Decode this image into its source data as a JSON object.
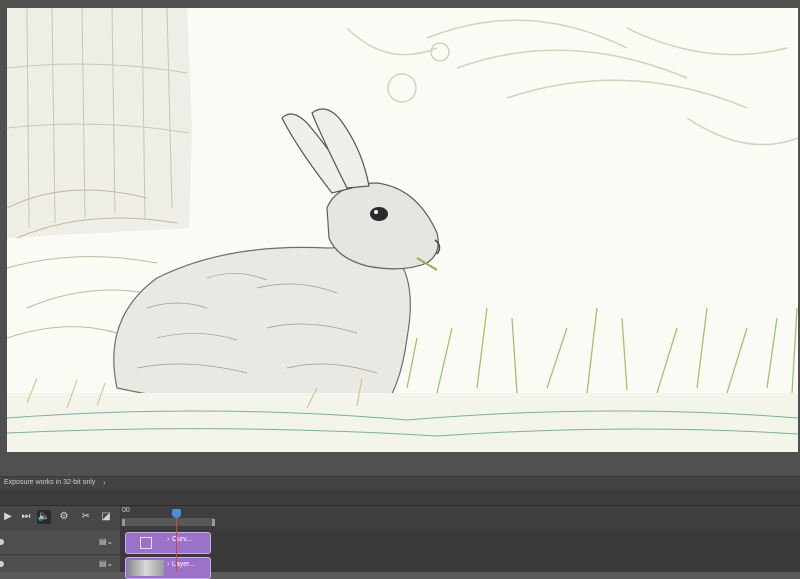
{
  "status": {
    "message": "Exposure works in 32-bit only",
    "chevron": "›"
  },
  "timeline": {
    "ruler_label": "00",
    "controls": [
      {
        "name": "play-icon",
        "glyph": "▶"
      },
      {
        "name": "step-forward-icon",
        "glyph": "⏭"
      },
      {
        "name": "audio-icon",
        "glyph": "🔈"
      },
      {
        "name": "settings-icon",
        "glyph": "⚙"
      },
      {
        "name": "split-scissors-icon",
        "glyph": "✂"
      },
      {
        "name": "transition-icon",
        "glyph": "◪"
      }
    ],
    "tracks": [
      {
        "clip_label": "Curv...",
        "chevron": "›"
      },
      {
        "clip_label": "Layer...",
        "chevron": "›"
      }
    ]
  },
  "document": {
    "subject": "sketch-rabbit-image"
  }
}
